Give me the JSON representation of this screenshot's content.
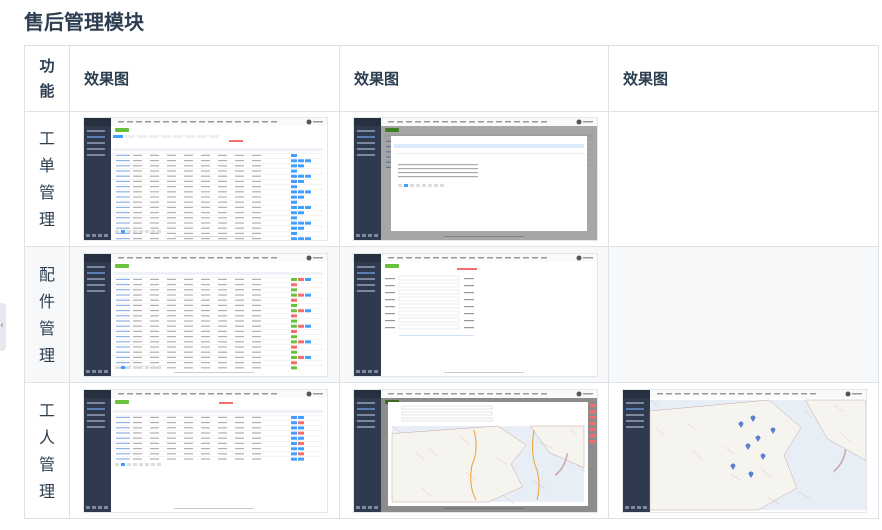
{
  "page": {
    "heading": "售后管理模块",
    "headers": [
      "功能",
      "效果图",
      "效果图",
      "效果图"
    ]
  },
  "rows": [
    {
      "label": "工单管理",
      "shots": [
        "list",
        "dialog",
        "none"
      ]
    },
    {
      "label": "配件管理",
      "shots": [
        "list",
        "form",
        "none"
      ]
    },
    {
      "label": "工人管理",
      "shots": [
        "list",
        "mapdialog",
        "map"
      ]
    }
  ],
  "colors": {
    "sidebar": "#2f3a4f",
    "accent": "#409eff",
    "green": "#67c23a",
    "red": "#f56c6c",
    "border": "#dfe2e5",
    "heading": "#2c3e50"
  }
}
